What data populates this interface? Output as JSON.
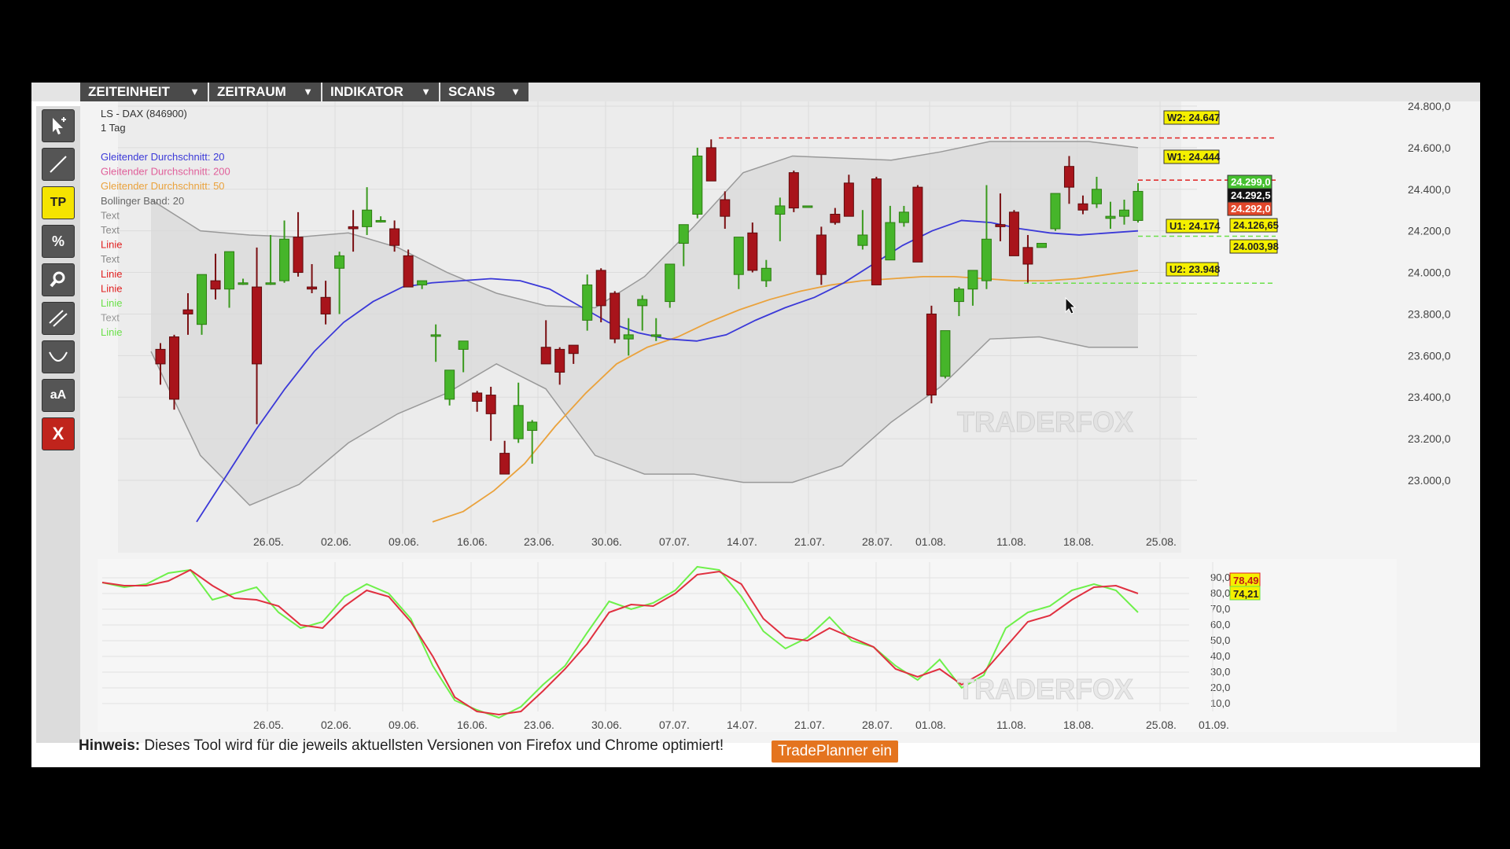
{
  "menu": [
    {
      "label": "ZEITEINHEIT",
      "arrow": "▼"
    },
    {
      "label": "ZEITRAUM",
      "arrow": "▼"
    },
    {
      "label": "INDIKATOR",
      "arrow": "▼"
    },
    {
      "label": "SCANS",
      "arrow": "▼"
    }
  ],
  "tools": [
    {
      "name": "pointer-tool-icon"
    },
    {
      "name": "line-tool-icon"
    },
    {
      "name": "tp-button",
      "label": "TP",
      "color": "#f5e400"
    },
    {
      "name": "percent-tool-icon",
      "label": "%"
    },
    {
      "name": "zoom-tool-icon"
    },
    {
      "name": "parallel-lines-tool-icon"
    },
    {
      "name": "curve-tool-icon"
    },
    {
      "name": "text-size-tool",
      "label": "aA"
    },
    {
      "name": "delete-tool-button",
      "label": "X",
      "color": "#c0241c"
    }
  ],
  "legend": {
    "title": "LS - DAX (846900)",
    "timeframe": "1 Tag",
    "items": [
      {
        "text": "Gleitender Durchschnitt: 20",
        "color": "#3b39d8"
      },
      {
        "text": "Gleitender Durchschnitt: 200",
        "color": "#e0609a"
      },
      {
        "text": "Gleitender Durchschnitt: 50",
        "color": "#eaa23c"
      },
      {
        "text": "Bollinger Band: 20",
        "color": "#666666"
      },
      {
        "text": "Text",
        "color": "#8a8a8a"
      },
      {
        "text": "Text",
        "color": "#8a8a8a"
      },
      {
        "text": "Linie",
        "color": "#e02020"
      },
      {
        "text": "Text",
        "color": "#8a8a8a"
      },
      {
        "text": "Linie",
        "color": "#e02020"
      },
      {
        "text": "Linie",
        "color": "#e02020"
      },
      {
        "text": "Linie",
        "color": "#6be04a"
      },
      {
        "text": "Text",
        "color": "#9a9a9a"
      },
      {
        "text": "Linie",
        "color": "#6be04a"
      }
    ]
  },
  "price_labels": {
    "w2": "W2: 24.647",
    "w1": "W1: 24.444",
    "u1": "U1: 24.174",
    "u2": "U2: 23.948",
    "high": "24.299,0",
    "last": "24.292,5",
    "low": "24.292,0",
    "ma20": "24.126,65",
    "ma50": "24.003,98"
  },
  "osc_labels": {
    "red": "78,49",
    "green": "74,21"
  },
  "watermark": "TRADERFOX",
  "notice": {
    "bold": "Hinweis:",
    "text": " Dieses Tool wird für die jeweils aktuellsten Versionen von Firefox und Chrome optimiert!"
  },
  "tradeplanner_button": "TradePlanner ein",
  "chart_data": [
    {
      "type": "candlestick",
      "title": "LS - DAX (846900)",
      "y_ticks": [
        "23.000,0",
        "23.200,0",
        "23.400,0",
        "23.600,0",
        "23.800,0",
        "24.000,0",
        "24.200,0",
        "24.400,0",
        "24.600,0",
        "24.800,0"
      ],
      "x_ticks": [
        "26.05.",
        "02.06.",
        "09.06.",
        "16.06.",
        "23.06.",
        "30.06.",
        "07.07.",
        "14.07.",
        "21.07.",
        "28.07.",
        "01.08.",
        "11.08.",
        "18.08.",
        "25.08."
      ],
      "ylim": [
        22800,
        24830
      ],
      "candles": [
        {
          "o": 23630,
          "h": 23660,
          "l": 23460,
          "c": 23560
        },
        {
          "o": 23690,
          "h": 23700,
          "l": 23340,
          "c": 23390
        },
        {
          "o": 23820,
          "h": 23900,
          "l": 23700,
          "c": 23800
        },
        {
          "o": 23750,
          "h": 23970,
          "l": 23700,
          "c": 23990
        },
        {
          "o": 23960,
          "h": 24090,
          "l": 23870,
          "c": 23920
        },
        {
          "o": 23920,
          "h": 24100,
          "l": 23830,
          "c": 24100
        },
        {
          "o": 23950,
          "h": 23970,
          "l": 23940,
          "c": 23950
        },
        {
          "o": 23930,
          "h": 24120,
          "l": 23270,
          "c": 23560
        },
        {
          "o": 23950,
          "h": 24180,
          "l": 23940,
          "c": 23950
        },
        {
          "o": 23960,
          "h": 24250,
          "l": 23950,
          "c": 24160
        },
        {
          "o": 24170,
          "h": 24290,
          "l": 23980,
          "c": 24000
        },
        {
          "o": 23930,
          "h": 24040,
          "l": 23900,
          "c": 23920
        },
        {
          "o": 23880,
          "h": 23960,
          "l": 23750,
          "c": 23800
        },
        {
          "o": 24020,
          "h": 24100,
          "l": 23800,
          "c": 24080
        },
        {
          "o": 24220,
          "h": 24300,
          "l": 24100,
          "c": 24210
        },
        {
          "o": 24220,
          "h": 24410,
          "l": 24180,
          "c": 24300
        },
        {
          "o": 24250,
          "h": 24270,
          "l": 24240,
          "c": 24250
        },
        {
          "o": 24210,
          "h": 24250,
          "l": 24100,
          "c": 24130
        },
        {
          "o": 24080,
          "h": 24110,
          "l": 23940,
          "c": 23930
        },
        {
          "o": 23940,
          "h": 23950,
          "l": 23920,
          "c": 23960
        },
        {
          "o": 23700,
          "h": 23750,
          "l": 23570,
          "c": 23700
        },
        {
          "o": 23390,
          "h": 23450,
          "l": 23360,
          "c": 23530
        },
        {
          "o": 23630,
          "h": 23640,
          "l": 23520,
          "c": 23670
        },
        {
          "o": 23420,
          "h": 23430,
          "l": 23330,
          "c": 23380
        },
        {
          "o": 23410,
          "h": 23450,
          "l": 23190,
          "c": 23320
        },
        {
          "o": 23130,
          "h": 23190,
          "l": 23050,
          "c": 23030
        },
        {
          "o": 23200,
          "h": 23470,
          "l": 23180,
          "c": 23360
        },
        {
          "o": 23240,
          "h": 23290,
          "l": 23080,
          "c": 23280
        },
        {
          "o": 23640,
          "h": 23770,
          "l": 23580,
          "c": 23560
        },
        {
          "o": 23630,
          "h": 23640,
          "l": 23460,
          "c": 23520
        },
        {
          "o": 23650,
          "h": 23640,
          "l": 23560,
          "c": 23610
        },
        {
          "o": 23770,
          "h": 23990,
          "l": 23720,
          "c": 23940
        },
        {
          "o": 24010,
          "h": 24020,
          "l": 23760,
          "c": 23840
        },
        {
          "o": 23900,
          "h": 23910,
          "l": 23660,
          "c": 23680
        },
        {
          "o": 23680,
          "h": 23780,
          "l": 23600,
          "c": 23700
        },
        {
          "o": 23840,
          "h": 23890,
          "l": 23720,
          "c": 23870
        },
        {
          "o": 23700,
          "h": 23780,
          "l": 23670,
          "c": 23700
        },
        {
          "o": 23860,
          "h": 24030,
          "l": 23830,
          "c": 24040
        },
        {
          "o": 24140,
          "h": 24170,
          "l": 24030,
          "c": 24230
        },
        {
          "o": 24280,
          "h": 24600,
          "l": 24260,
          "c": 24560
        },
        {
          "o": 24600,
          "h": 24640,
          "l": 24440,
          "c": 24440
        },
        {
          "o": 24350,
          "h": 24390,
          "l": 24210,
          "c": 24270
        },
        {
          "o": 23990,
          "h": 24130,
          "l": 23920,
          "c": 24170
        },
        {
          "o": 24190,
          "h": 24240,
          "l": 24000,
          "c": 24010
        },
        {
          "o": 23960,
          "h": 24060,
          "l": 23930,
          "c": 24020
        },
        {
          "o": 24280,
          "h": 24360,
          "l": 24150,
          "c": 24320
        },
        {
          "o": 24480,
          "h": 24490,
          "l": 24290,
          "c": 24310
        },
        {
          "o": 24320,
          "h": 24300,
          "l": 24320,
          "c": 24320
        },
        {
          "o": 24180,
          "h": 24220,
          "l": 23940,
          "c": 23990
        },
        {
          "o": 24280,
          "h": 24310,
          "l": 24230,
          "c": 24240
        },
        {
          "o": 24430,
          "h": 24470,
          "l": 24270,
          "c": 24270
        },
        {
          "o": 24130,
          "h": 24300,
          "l": 24110,
          "c": 24180
        },
        {
          "o": 24450,
          "h": 24460,
          "l": 23960,
          "c": 23940
        },
        {
          "o": 24060,
          "h": 24320,
          "l": 24060,
          "c": 24240
        },
        {
          "o": 24240,
          "h": 24320,
          "l": 24220,
          "c": 24290
        },
        {
          "o": 24410,
          "h": 24420,
          "l": 24070,
          "c": 24050
        },
        {
          "o": 23800,
          "h": 23840,
          "l": 23370,
          "c": 23410
        },
        {
          "o": 23500,
          "h": 23720,
          "l": 23490,
          "c": 23720
        },
        {
          "o": 23860,
          "h": 23930,
          "l": 23790,
          "c": 23920
        },
        {
          "o": 23920,
          "h": 24000,
          "l": 23840,
          "c": 24010
        },
        {
          "o": 23960,
          "h": 24420,
          "l": 23920,
          "c": 24160
        },
        {
          "o": 24230,
          "h": 24380,
          "l": 24150,
          "c": 24220
        },
        {
          "o": 24290,
          "h": 24300,
          "l": 24090,
          "c": 24080
        },
        {
          "o": 24120,
          "h": 24180,
          "l": 23950,
          "c": 24040
        },
        {
          "o": 24120,
          "h": 24110,
          "l": 24170,
          "c": 24140
        },
        {
          "o": 24210,
          "h": 24330,
          "l": 24200,
          "c": 24380
        },
        {
          "o": 24510,
          "h": 24560,
          "l": 24330,
          "c": 24410
        },
        {
          "o": 24330,
          "h": 24370,
          "l": 24280,
          "c": 24300
        },
        {
          "o": 24330,
          "h": 24460,
          "l": 24310,
          "c": 24400
        },
        {
          "o": 24260,
          "h": 24340,
          "l": 24210,
          "c": 24270
        },
        {
          "o": 24270,
          "h": 24350,
          "l": 24230,
          "c": 24300
        },
        {
          "o": 24250,
          "h": 24430,
          "l": 24240,
          "c": 24390
        }
      ],
      "ma20": [
        22800,
        23020,
        23240,
        23440,
        23620,
        23760,
        23860,
        23930,
        23950,
        23960,
        23970,
        23960,
        23920,
        23840,
        23760,
        23710,
        23680,
        23670,
        23700,
        23770,
        23830,
        23880,
        23950,
        24040,
        24130,
        24200,
        24250,
        24240,
        24210,
        24190,
        24180,
        24190,
        24200
      ],
      "ma50": [
        22800,
        22850,
        22950,
        23080,
        23260,
        23420,
        23560,
        23640,
        23690,
        23760,
        23820,
        23870,
        23910,
        23940,
        23960,
        23970,
        23980,
        23980,
        23970,
        23960,
        23960,
        23970,
        23990,
        24010
      ],
      "bb_upper": [
        24350,
        24200,
        24180,
        24170,
        24190,
        24120,
        24000,
        23900,
        23840,
        23830,
        23980,
        24220,
        24480,
        24560,
        24550,
        24540,
        24580,
        24630,
        24630,
        24630,
        24600
      ],
      "bb_lower": [
        23620,
        23120,
        22880,
        22980,
        23180,
        23320,
        23420,
        23560,
        23440,
        23120,
        23030,
        23030,
        22990,
        22990,
        23070,
        23280,
        23450,
        23680,
        23690,
        23640,
        23640
      ],
      "levels": [
        {
          "name": "W2",
          "value": 24647
        },
        {
          "name": "W1",
          "value": 24444
        },
        {
          "name": "U1",
          "value": 24174
        },
        {
          "name": "U2",
          "value": 23948
        }
      ]
    },
    {
      "type": "line",
      "title": "",
      "y_ticks": [
        "10,0",
        "20,0",
        "30,0",
        "40,0",
        "50,0",
        "60,0",
        "70,0",
        "80,0",
        "90,0"
      ],
      "x_ticks": [
        "26.05.",
        "02.06.",
        "09.06.",
        "16.06.",
        "23.06.",
        "30.06.",
        "07.07.",
        "14.07.",
        "21.07.",
        "28.07.",
        "01.08.",
        "11.08.",
        "18.08.",
        "25.08.",
        "01.09."
      ],
      "ylim": [
        0,
        95
      ],
      "series": [
        {
          "name": "",
          "color": "#6ef04a",
          "values": [
            87,
            84,
            86,
            93,
            95,
            76,
            80,
            84,
            68,
            58,
            62,
            78,
            86,
            80,
            64,
            34,
            12,
            6,
            1,
            8,
            22,
            34,
            55,
            75,
            70,
            74,
            82,
            97,
            95,
            78,
            56,
            45,
            52,
            65,
            50,
            46,
            34,
            25,
            38,
            20,
            28,
            58,
            68,
            72,
            82,
            86,
            82,
            68
          ]
        },
        {
          "name": "",
          "color": "#e03040",
          "values": [
            87,
            85,
            85,
            88,
            95,
            85,
            77,
            76,
            72,
            60,
            58,
            72,
            82,
            78,
            62,
            40,
            14,
            5,
            3,
            5,
            18,
            32,
            48,
            68,
            73,
            72,
            80,
            92,
            94,
            86,
            64,
            52,
            50,
            58,
            52,
            46,
            32,
            27,
            32,
            22,
            30,
            46,
            62,
            66,
            76,
            84,
            85,
            80
          ]
        }
      ]
    }
  ]
}
